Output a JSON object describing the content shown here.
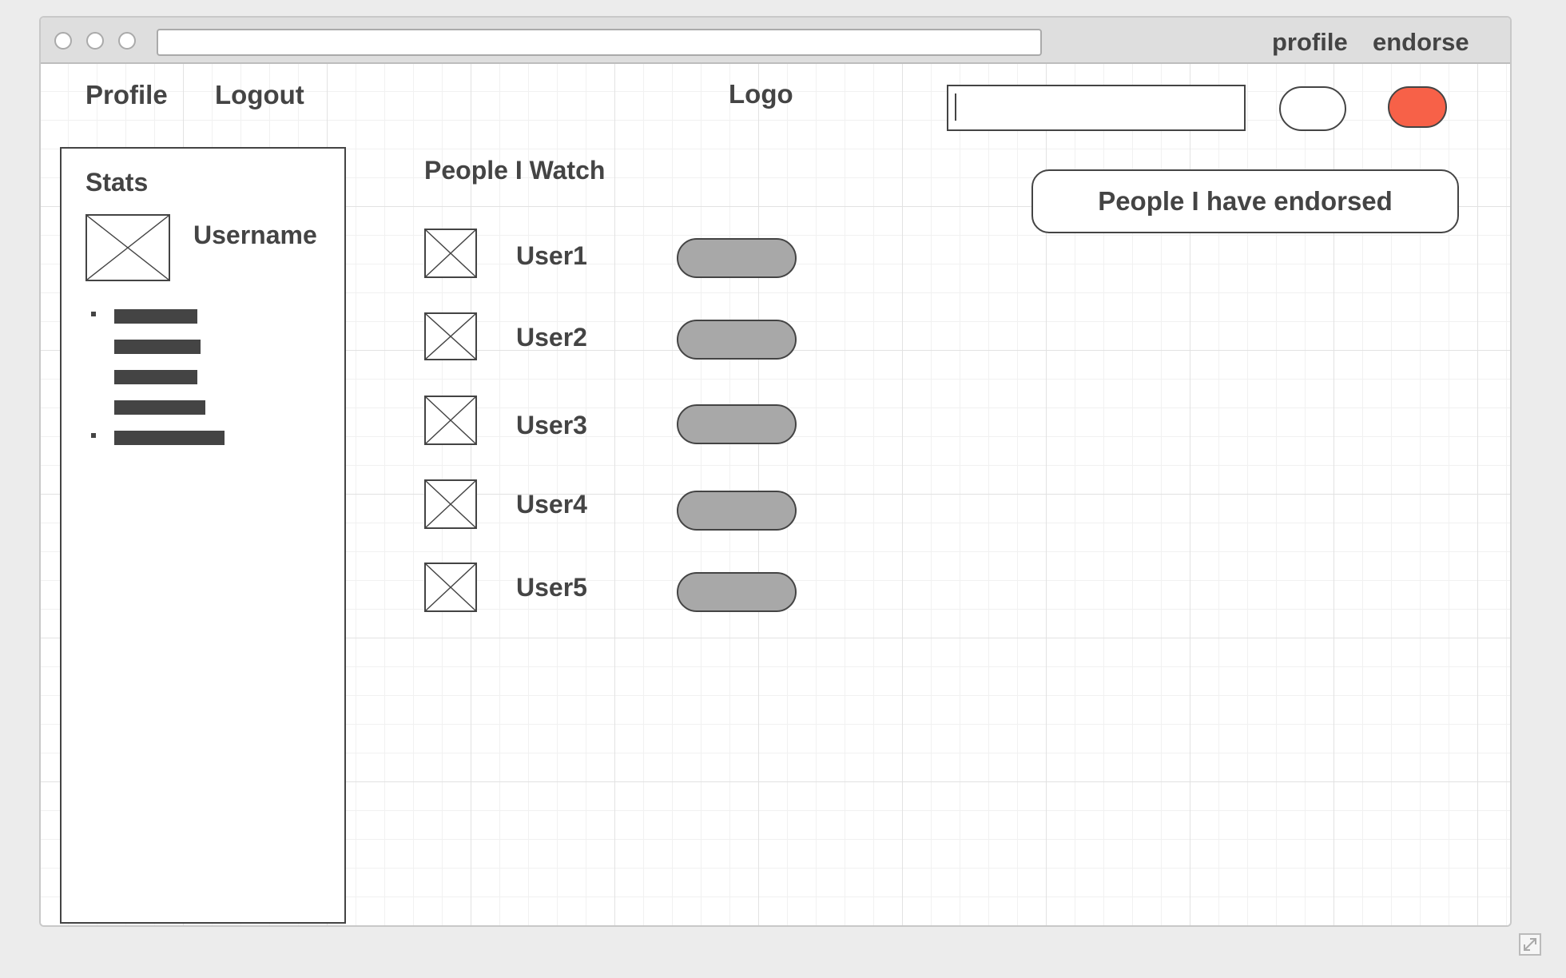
{
  "window": {
    "top_links": [
      "profile",
      "endorse"
    ],
    "address_value": ""
  },
  "nav": {
    "profile": "Profile",
    "logout": "Logout",
    "logo": "Logo"
  },
  "search": {
    "value": ""
  },
  "colors": {
    "accent": "#f76148",
    "user_button": "#a8a8a8",
    "ink": "#444444"
  },
  "sidebar": {
    "title": "Stats",
    "username": "Username",
    "list_bullets": 2
  },
  "watch": {
    "heading": "People I Watch",
    "users": [
      "User1",
      "User2",
      "User3",
      "User4",
      "User5"
    ]
  },
  "endorsed": {
    "label": "People I have endorsed"
  }
}
